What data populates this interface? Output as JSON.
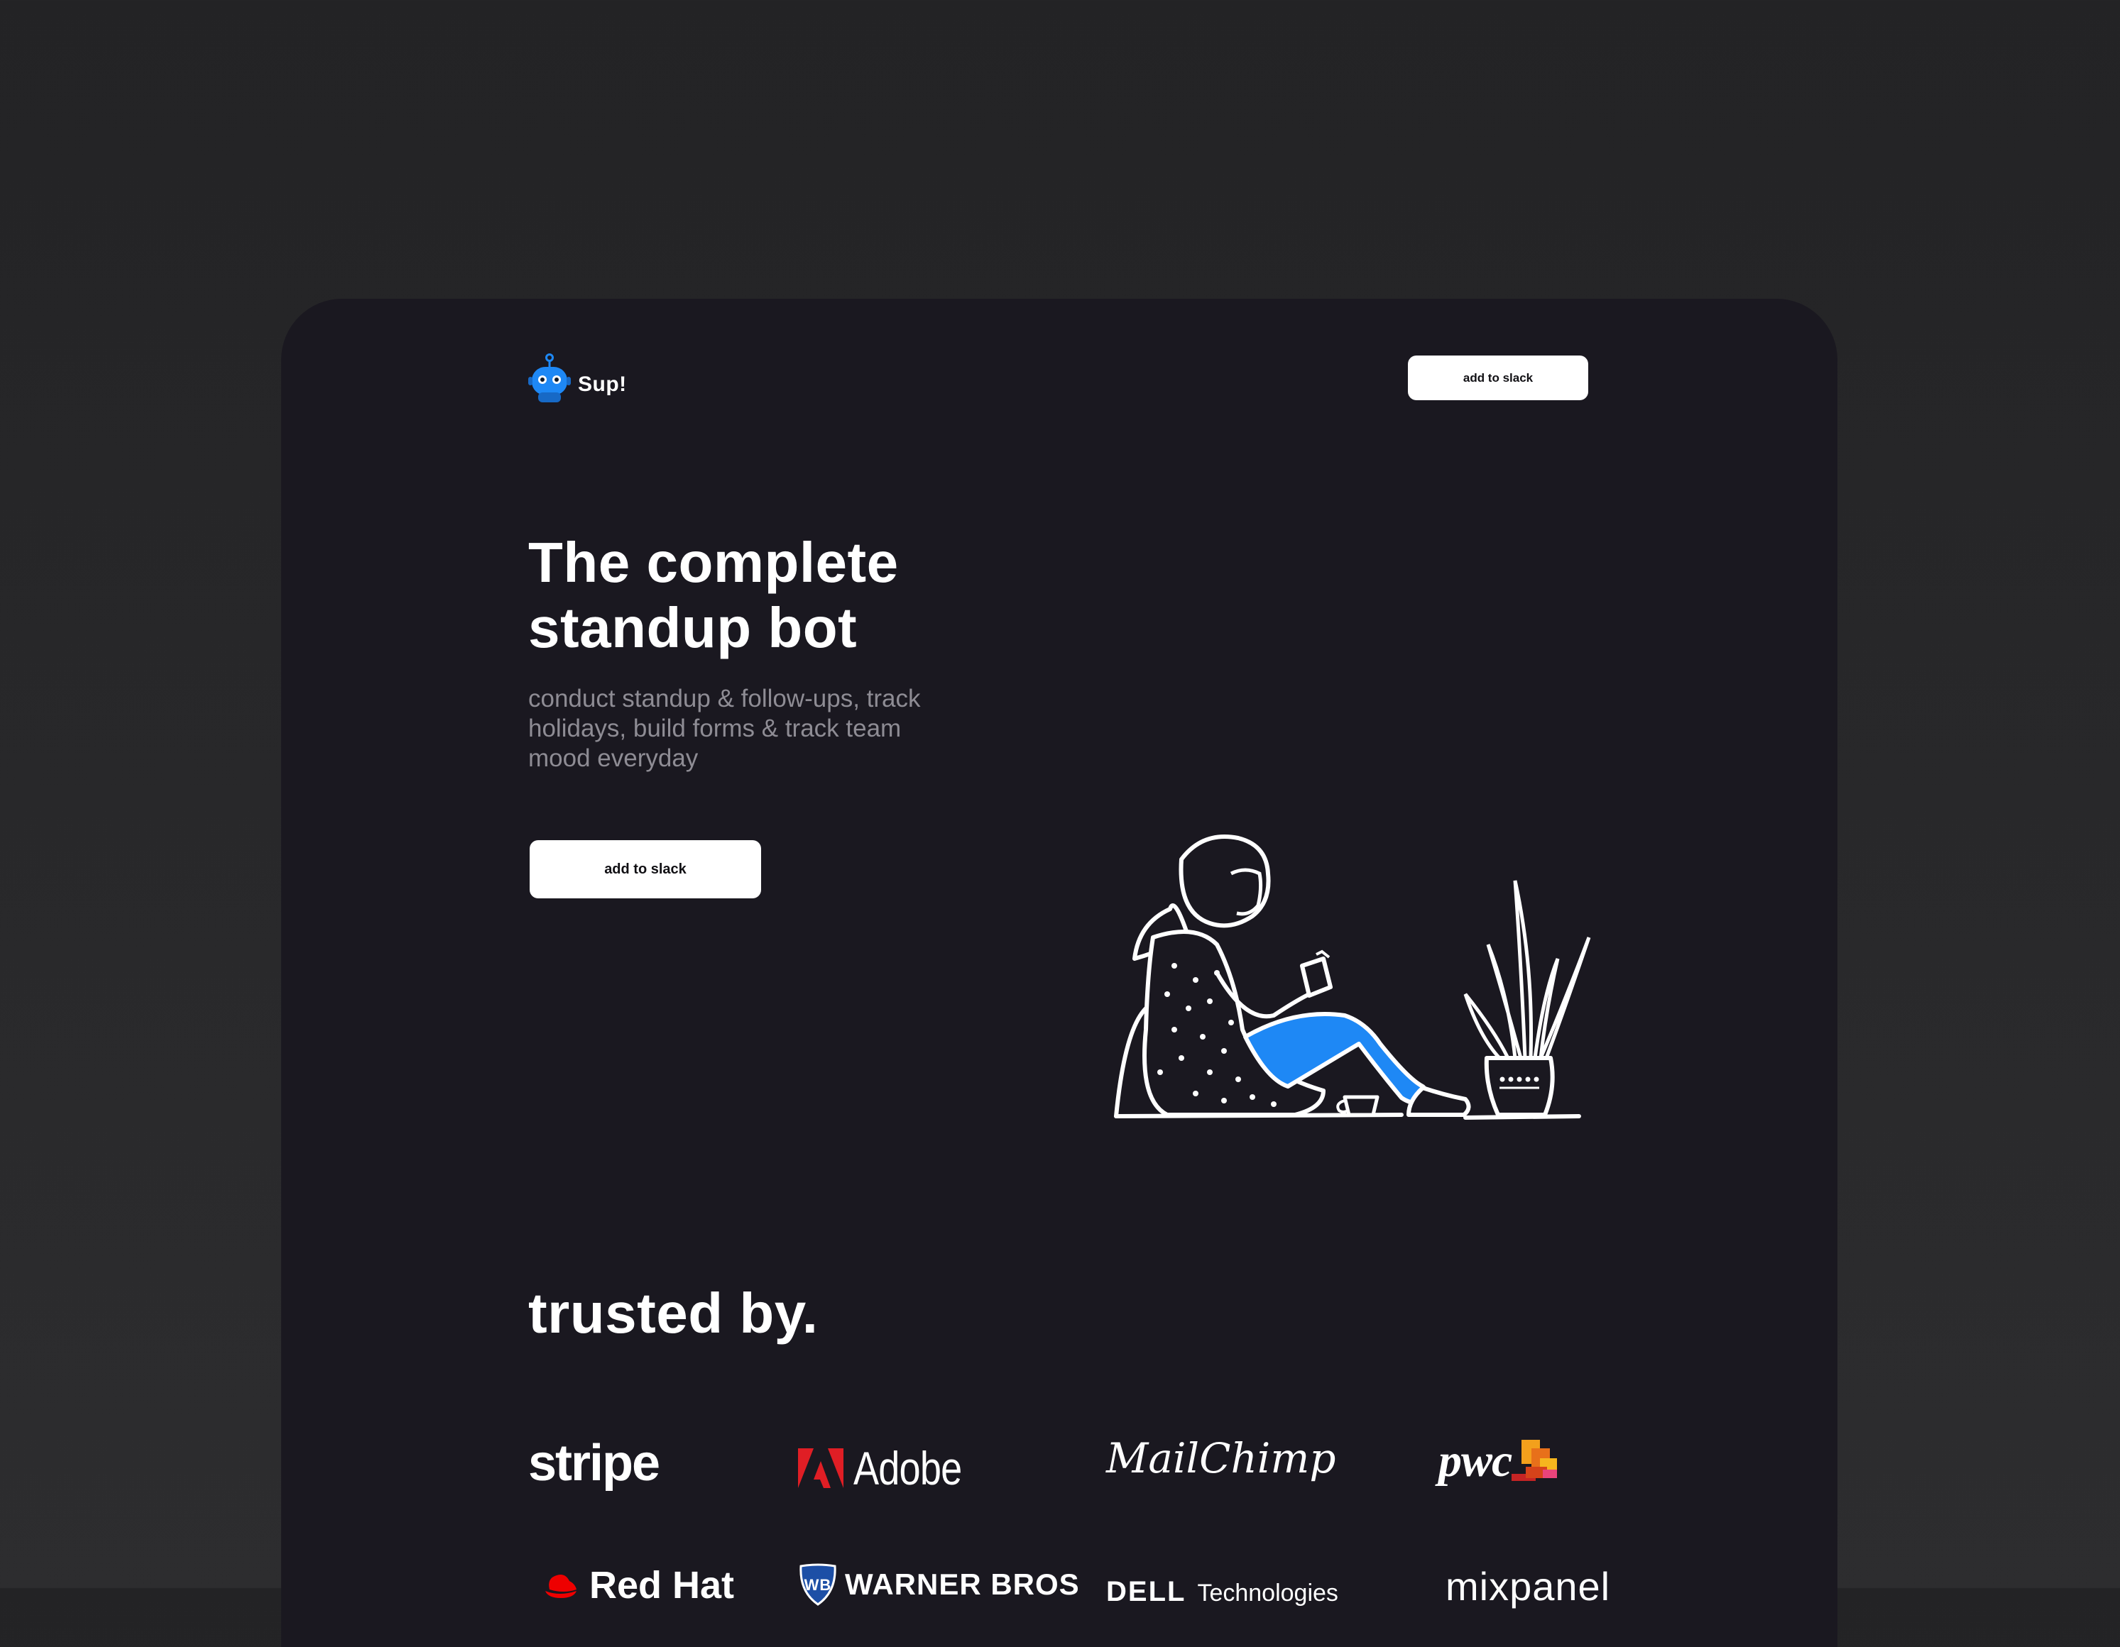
{
  "brand": {
    "name": "Sup!",
    "icon": "robot-icon",
    "accent_color": "#1e88f5"
  },
  "nav": {
    "cta_label": "add to slack"
  },
  "hero": {
    "title": "The complete standup bot",
    "subtitle": "conduct standup & follow-ups, track holidays, build forms & track team mood everyday",
    "cta_label": "add to slack",
    "illustration": "woman-reading-illustration"
  },
  "trusted": {
    "title": "trusted by.",
    "logos": [
      {
        "name": "stripe",
        "icon": "stripe-logo"
      },
      {
        "name": "Adobe",
        "icon": "adobe-logo"
      },
      {
        "name": "MailChimp",
        "icon": "mailchimp-logo"
      },
      {
        "name": "pwc",
        "icon": "pwc-logo"
      },
      {
        "name": "Red Hat",
        "icon": "redhat-logo"
      },
      {
        "name": "WARNER BROS",
        "icon": "warner-bros-logo"
      },
      {
        "name": "DELL",
        "sub": "Technologies",
        "icon": "dell-technologies-logo"
      },
      {
        "name": "mixpanel",
        "icon": "mixpanel-logo"
      }
    ]
  },
  "colors": {
    "page_background": "#2b2b2d",
    "card_background": "#1a1820",
    "subtitle_text": "#8e8c94",
    "button_background": "#ffffff",
    "adobe_red": "#e01e25",
    "redhat_red": "#ee0000",
    "wb_blue": "#1d4fa6"
  }
}
